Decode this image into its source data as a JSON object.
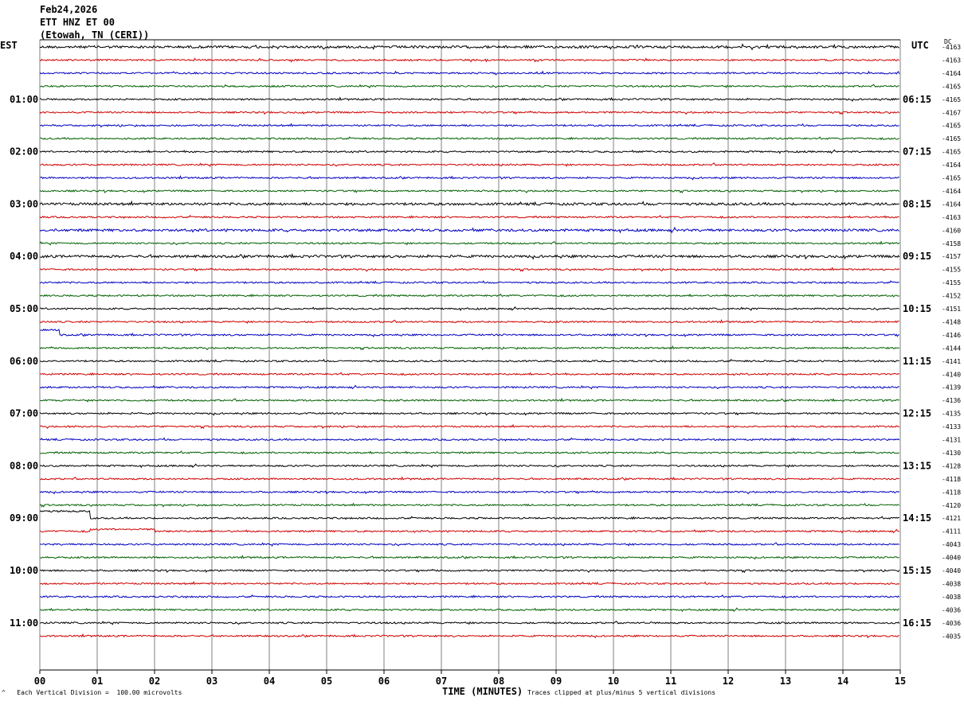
{
  "header": {
    "date": "Feb24,2026",
    "station": "ETT HNZ ET 00",
    "location": "(Etowah, TN (CERI))"
  },
  "left_timezone": "EST",
  "right_timezone": "UTC",
  "dc_label": "DC",
  "footer": {
    "left_mark": "^",
    "vertical_division": "Each Vertical Division =  100.00 microvolts",
    "xlabel": "TIME (MINUTES)",
    "clip_note": "Traces clipped at plus/minus 5 vertical divisions"
  },
  "colors": {
    "trace_cycle": [
      "#000000",
      "#d00000",
      "#0000c0",
      "#006000"
    ],
    "grid": "#808080",
    "background": "#ffffff"
  },
  "chart_data": {
    "type": "line",
    "title": "",
    "xlabel": "TIME (MINUTES)",
    "xlim": [
      0,
      15
    ],
    "x_ticks": [
      "00",
      "01",
      "02",
      "03",
      "04",
      "05",
      "06",
      "07",
      "08",
      "09",
      "10",
      "11",
      "12",
      "13",
      "14",
      "15"
    ],
    "row_interval_minutes": 15,
    "left_hour_labels": [
      "01:00",
      "02:00",
      "03:00",
      "04:00",
      "05:00",
      "06:00",
      "07:00",
      "08:00",
      "09:00",
      "10:00",
      "11:00"
    ],
    "right_hour_labels": [
      "06:15",
      "07:15",
      "08:15",
      "09:15",
      "10:15",
      "11:15",
      "12:15",
      "13:15",
      "14:15",
      "15:15",
      "16:15"
    ],
    "dc_offsets": [
      "-4163",
      "-4163",
      "-4164",
      "-4165",
      "-4165",
      "-4167",
      "-4165",
      "-4165",
      "-4165",
      "-4164",
      "-4165",
      "-4164",
      "-4164",
      "-4163",
      "-4160",
      "-4158",
      "-4157",
      "-4155",
      "-4155",
      "-4152",
      "-4151",
      "-4148",
      "-4146",
      "-4144",
      "-4141",
      "-4140",
      "-4139",
      "-4136",
      "-4135",
      "-4133",
      "-4131",
      "-4130",
      "-4128",
      "-4118",
      "-4118",
      "-4120",
      "-4121",
      "-4111",
      "-4043",
      "-4040",
      "-4040",
      "-4038",
      "-4038",
      "-4036",
      "-4036",
      "-4035"
    ],
    "noise_level": [
      3,
      2,
      2,
      2,
      2,
      2,
      2,
      2,
      2,
      2,
      2,
      2,
      3,
      2,
      3,
      2,
      3,
      2,
      2,
      2,
      2,
      2,
      2,
      2,
      2,
      2,
      2,
      2,
      2,
      2,
      2,
      2,
      2,
      2,
      2,
      2,
      2,
      2,
      2,
      2,
      2,
      2,
      2,
      2,
      2,
      2
    ],
    "events": [
      {
        "row": 22,
        "minute_start": 0.0,
        "minute_end": 0.35,
        "offset_divisions": 1.3
      },
      {
        "row": 36,
        "minute_start": 0.0,
        "minute_end": 0.88,
        "offset_divisions": 1.8
      },
      {
        "row": 37,
        "minute_start": 0.88,
        "minute_end": 2.0,
        "offset_divisions": 0.5
      }
    ]
  }
}
